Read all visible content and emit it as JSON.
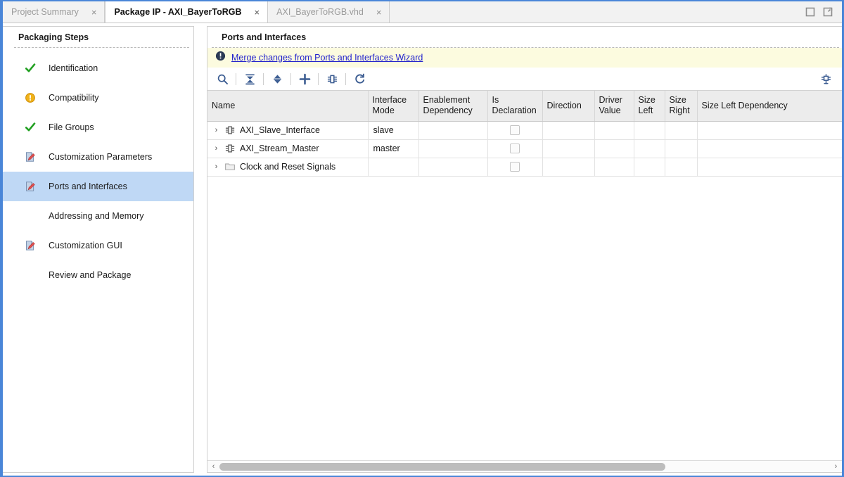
{
  "window": {
    "controls": [
      {
        "name": "maximize-button",
        "icon": "square-icon",
        "label": "Maximize"
      },
      {
        "name": "float-button",
        "icon": "float-window-icon",
        "label": "Float"
      }
    ]
  },
  "tabs": [
    {
      "label": "Project Summary",
      "close": "×",
      "active": false
    },
    {
      "label": "Package IP - AXI_BayerToRGB",
      "close": "×",
      "active": true
    },
    {
      "label": "AXI_BayerToRGB.vhd",
      "close": "×",
      "active": false
    }
  ],
  "sidebar": {
    "title": "Packaging Steps",
    "items": [
      {
        "label": "Identification",
        "icon": "check-icon",
        "state": "done",
        "selected": false
      },
      {
        "label": "Compatibility",
        "icon": "warning-icon",
        "state": "warning",
        "selected": false
      },
      {
        "label": "File Groups",
        "icon": "check-icon",
        "state": "done",
        "selected": false
      },
      {
        "label": "Customization Parameters",
        "icon": "edited-page-icon",
        "state": "edited",
        "selected": false
      },
      {
        "label": "Ports and Interfaces",
        "icon": "edited-page-icon",
        "state": "edited",
        "selected": true
      },
      {
        "label": "Addressing and Memory",
        "icon": "none",
        "state": "none",
        "selected": false
      },
      {
        "label": "Customization GUI",
        "icon": "edited-page-icon",
        "state": "edited",
        "selected": false
      },
      {
        "label": "Review and Package",
        "icon": "none",
        "state": "none",
        "selected": false
      }
    ]
  },
  "main": {
    "title": "Ports and Interfaces",
    "info_banner": {
      "icon": "info-exclamation-icon",
      "link_text": "Merge changes from Ports and Interfaces Wizard"
    },
    "toolbar": [
      {
        "name": "search-button",
        "icon": "search-icon",
        "title": "Search"
      },
      {
        "name": "collapse-all-button",
        "icon": "collapse-all-icon",
        "title": "Collapse All"
      },
      {
        "name": "expand-collapse-button",
        "icon": "expand-collapse-icon",
        "title": "Expand All"
      },
      {
        "name": "add-button",
        "icon": "plus-icon",
        "title": "Add"
      },
      {
        "name": "add-interface-button",
        "icon": "bus-interface-icon",
        "title": "Add Interface"
      },
      {
        "name": "refresh-button",
        "icon": "refresh-icon",
        "title": "Refresh"
      }
    ],
    "toolbar_right": {
      "name": "auto-infer-button",
      "icon": "ip-chip-icon",
      "title": "Auto Infer"
    },
    "table": {
      "columns": [
        "Name",
        "Interface Mode",
        "Enablement Dependency",
        "Is Declaration",
        "Direction",
        "Driver Value",
        "Size Left",
        "Size Right",
        "Size Left Dependency"
      ],
      "rows": [
        {
          "expander": "›",
          "icon": "bus-interface-icon",
          "name": "AXI_Slave_Interface",
          "interface_mode": "slave",
          "enablement_dependency": "",
          "is_declaration": false,
          "direction": "",
          "driver_value": "",
          "size_left": "",
          "size_right": "",
          "size_left_dependency": ""
        },
        {
          "expander": "›",
          "icon": "bus-interface-icon",
          "name": "AXI_Stream_Master",
          "interface_mode": "master",
          "enablement_dependency": "",
          "is_declaration": false,
          "direction": "",
          "driver_value": "",
          "size_left": "",
          "size_right": "",
          "size_left_dependency": ""
        },
        {
          "expander": "›",
          "icon": "folder-icon",
          "name": "Clock and Reset Signals",
          "interface_mode": "",
          "enablement_dependency": "",
          "is_declaration": false,
          "direction": "",
          "driver_value": "",
          "size_left": "",
          "size_right": "",
          "size_left_dependency": ""
        }
      ]
    },
    "hscroll": {
      "left_arrow": "‹",
      "right_arrow": "›",
      "thumb_percent": 73
    }
  },
  "colors": {
    "frame_blue": "#4a86d8",
    "selection_blue": "#bfd8f5",
    "banner_yellow": "#fcfbdf",
    "link_blue": "#2222cc",
    "icon_blue": "#3c5d92",
    "check_green": "#22a022",
    "warning_amber": "#f0b21a"
  }
}
